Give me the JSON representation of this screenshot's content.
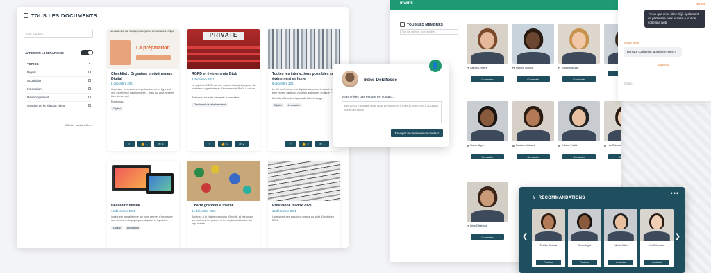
{
  "docs": {
    "title": "TOUS LES DOCUMENTS",
    "search_placeholder": "Voir par titre",
    "hierarchy_label": "AFFICHER L'HIÉRARCHIE",
    "topics_label": "TOPICS",
    "topics": [
      "Digital",
      "Acquisition",
      "Innovation",
      "Développement",
      "Gestion de la relation client"
    ],
    "show_filters": "Afficher tous les filtres",
    "cards": [
      {
        "title": "Checklist : Organiser un événement Digital",
        "date": "8 décembre 2021",
        "desc": "Organiser un événement professionnel en ligne est une expérience passionnante... mais qui peut générer bien du stress !",
        "more": "Pour vous...",
        "tags": [
          "Digital"
        ],
        "likes": "1",
        "comments": "1",
        "img_title": "La préparation",
        "img_caption": "Les étapes à ne pas manquer pour organiser son événement en ligne"
      },
      {
        "title": "RGPD et événements Btob",
        "date": "8 décembre 2021",
        "desc": "Le sujet du RGPD est une source d'inquiétude pour de nombreux organisateurs d'événements BtoB. À raison !",
        "more": "Retrouvez tous les éléments à connaître...",
        "tags": [
          "Gestion de la relation client"
        ],
        "likes": "0",
        "comments": "2",
        "img_word": "PRIVATE"
      },
      {
        "title": "Toutes les interactions possibles sur événement en ligne",
        "date": "8 décembre 2021",
        "desc": "Le clé de l'événement digital est comment réussir à bien rendre captivant pour les audiences en ligne ?",
        "more": "Il existe différentes façons de faire interagir...",
        "tags": [
          "Digital",
          "Innovation"
        ],
        "likes": "2",
        "comments": "1"
      },
      {
        "title": "Découvrir inwink",
        "date": "14 décembre 2021",
        "desc": "inwink est la plateforme qui vous permet d'orchestrer vos événements physiques, digitaux et hybrides.",
        "tags": [
          "Digital",
          "Innovation"
        ]
      },
      {
        "title": "Charte graphique inwink",
        "date": "14 décembre 2021",
        "desc": "Accédez à la charte graphique d'inwink, et retrouvez les couleurs, les polices et les règles d'utilisation du logo inwink.",
        "tags": []
      },
      {
        "title": "Pressbook inwink 2021",
        "date": "14 décembre 2021",
        "desc": "Un résumé des parutions presse au sujet d'inwink en 2021.",
        "tags": []
      }
    ]
  },
  "members": {
    "logo": "inwink",
    "title": "TOUS LES MEMBRES",
    "search_placeholder": "Voir par prénom, nom, société...",
    "contact_label": "Contacter",
    "people": [
      {
        "name": "Sabine Lemaire",
        "photo": {
          "bg": "#d8d1c8",
          "skin": "#e6b89a",
          "hair": "#7a4a2a"
        }
      },
      {
        "name": "Maxime Loreud",
        "photo": {
          "bg": "#c9d3dc",
          "skin": "#6b4630",
          "hair": "#2a1a12"
        }
      },
      {
        "name": "Rodolde Brunet",
        "photo": {
          "bg": "#dcd6cc",
          "skin": "#f0c8a8",
          "hair": "#c8924c"
        }
      },
      {
        "name": "",
        "photo": {
          "bg": "#ccd2d8",
          "skin": "#e0b090",
          "hair": "#3a2a20"
        }
      },
      {
        "name": "Simon Jégou",
        "photo": {
          "bg": "#c9cdd2",
          "skin": "#8a5a3c",
          "hair": "#1a1410"
        }
      },
      {
        "name": "Émeline Bertrand",
        "photo": {
          "bg": "#d6d0c8",
          "skin": "#b27a56",
          "hair": "#2a1a10"
        }
      },
      {
        "name": "Fabrice Caillet",
        "photo": {
          "bg": "#c8ccd0",
          "skin": "#e8c0a0",
          "hair": "#222222"
        }
      },
      {
        "name": "Léa Delormeau",
        "photo": {
          "bg": "#d8d4ce",
          "skin": "#f0d0b4",
          "hair": "#2a1a14"
        }
      },
      {
        "name": "Irène Delafosse",
        "photo": {
          "bg": "#d3cec6",
          "skin": "#c89a78",
          "hair": "#3a2418"
        }
      }
    ]
  },
  "chat": {
    "name": "Irène Delafosse",
    "question": "Vous n'êtes pas encore en contact...",
    "placeholder": "Entrez un message pour vous présenter et inciter la personne à accepter votre demande",
    "send_label": "Envoyer la demande de contact"
  },
  "messenger": {
    "meta_top": "Mes amis",
    "bubble_1": "J'ai vu que vous étiez déjà également un partenaire pour le mise à jour de votre site web",
    "meta_mid": "Rodolde Brunet",
    "bubble_2": "Bonjour Catherine, appelons-nous ?",
    "meta_low": "Aujourd'hui",
    "input_placeholder": "Écrire..."
  },
  "reco": {
    "title": "RECOMMANDATIONS",
    "contact_label": "Contacter",
    "people": [
      {
        "name": "Émeline Bertrand",
        "photo": {
          "bg": "#d6d0c8",
          "skin": "#b27a56",
          "hair": "#2a1a10"
        }
      },
      {
        "name": "Simon Jégou",
        "photo": {
          "bg": "#c9cdd2",
          "skin": "#8a5a3c",
          "hair": "#1a1410"
        }
      },
      {
        "name": "Fabrice Caillet",
        "photo": {
          "bg": "#c8ccd0",
          "skin": "#e8c0a0",
          "hair": "#222222"
        }
      },
      {
        "name": "Léa Delormeau",
        "photo": {
          "bg": "#d8d4ce",
          "skin": "#f0d0b4",
          "hair": "#2a1a14"
        }
      }
    ]
  },
  "colors": {
    "accent": "#1d9a72",
    "button": "#1f4e5f",
    "date": "#1c7fa5"
  }
}
